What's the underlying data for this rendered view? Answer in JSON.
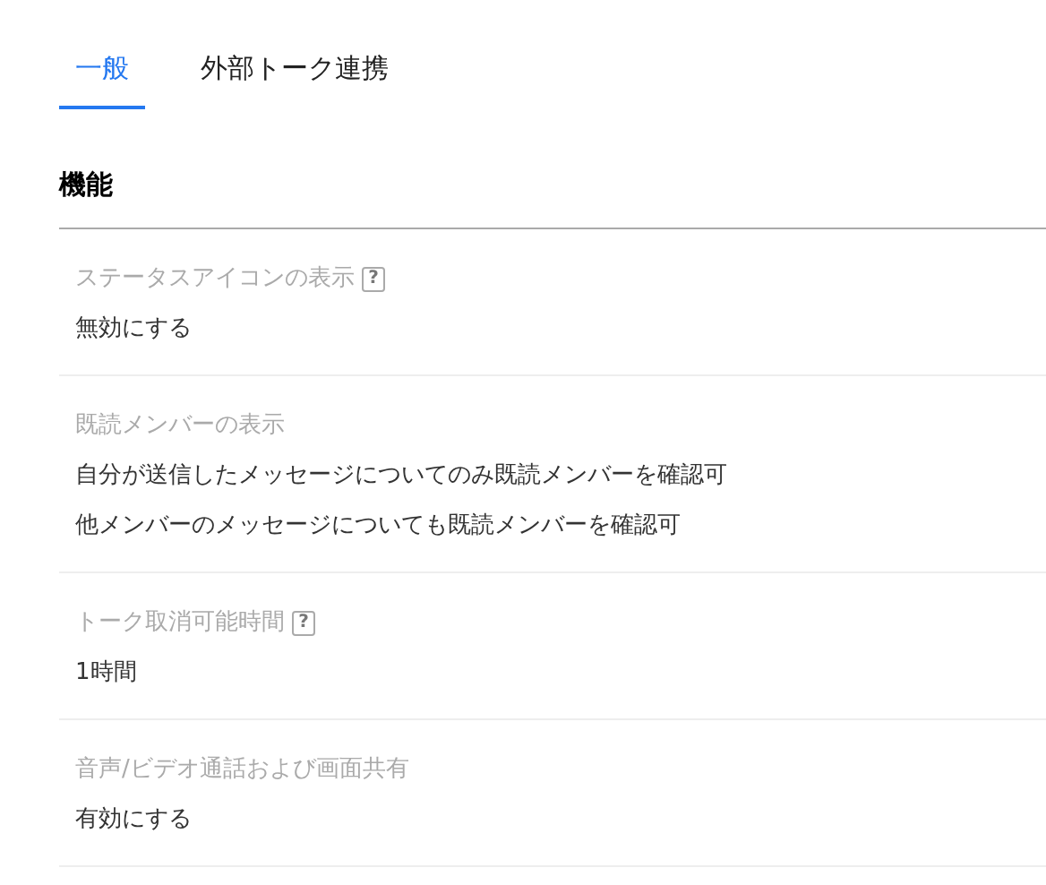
{
  "tabs": [
    {
      "label": "一般",
      "selected": true
    },
    {
      "label": "外部トーク連携",
      "selected": false
    }
  ],
  "section": {
    "title": "機能"
  },
  "settings": [
    {
      "label": "ステータスアイコンの表示",
      "help": "?",
      "values": [
        "無効にする"
      ]
    },
    {
      "label": "既読メンバーの表示",
      "values": [
        "自分が送信したメッセージについてのみ既読メンバーを確認可",
        "他メンバーのメッセージについても既読メンバーを確認可"
      ]
    },
    {
      "label": "トーク取消可能時間",
      "help": "?",
      "values": [
        "1時間"
      ]
    },
    {
      "label": "音声/ビデオ通話および画面共有",
      "values": [
        "有効にする"
      ]
    }
  ]
}
